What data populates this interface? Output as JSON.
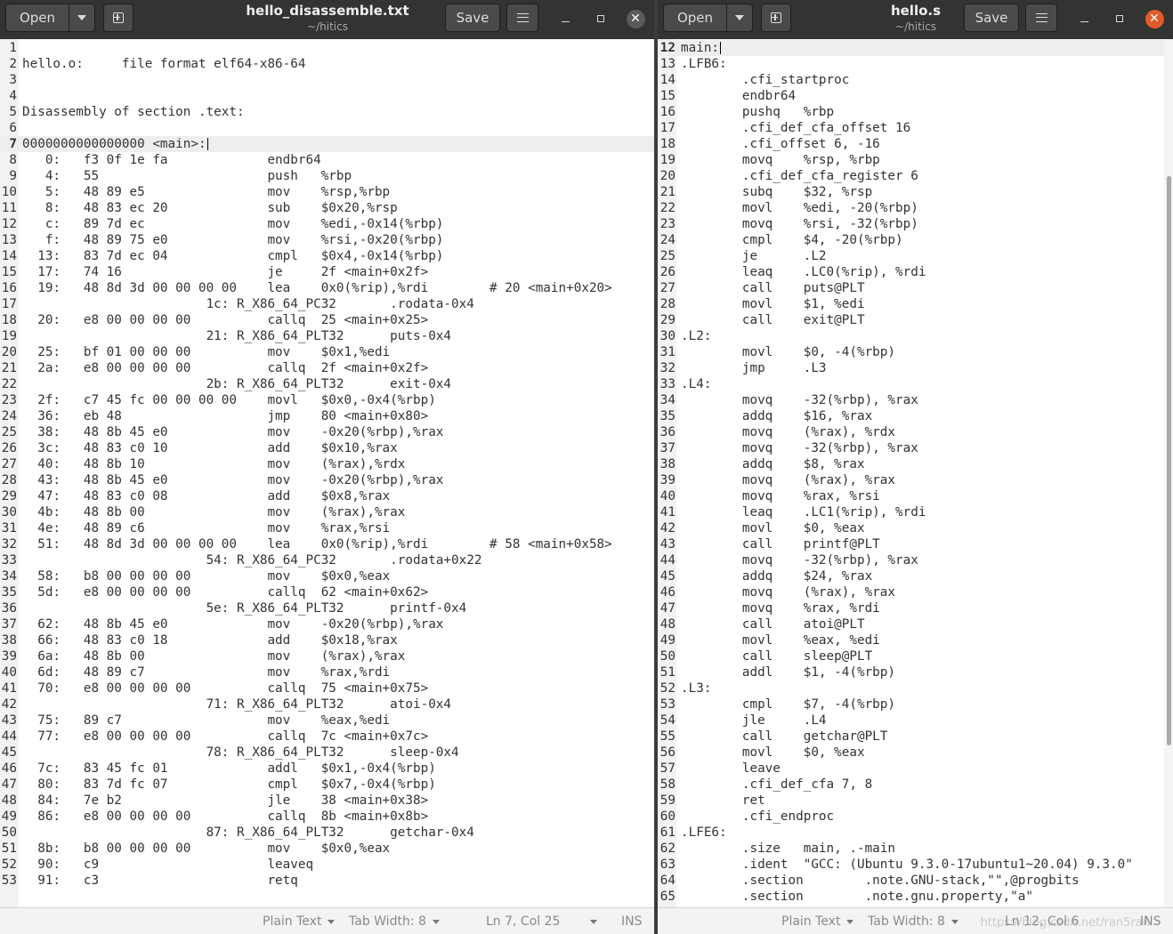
{
  "colors": {
    "header_bg": "#333333",
    "close_button": "#e35a2a",
    "editor_bg": "#ffffff",
    "current_line": "#eeeeec"
  },
  "left": {
    "open_label": "Open",
    "save_label": "Save",
    "title": "hello_disassemble.txt",
    "subtitle": "~/hitics",
    "current_line": 7,
    "lines": [
      "",
      "hello.o:     file format elf64-x86-64",
      "",
      "",
      "Disassembly of section .text:",
      "",
      "0000000000000000 <main>:",
      "   0:\tf3 0f 1e fa          \tendbr64 ",
      "   4:\t55                   \tpush   %rbp",
      "   5:\t48 89 e5             \tmov    %rsp,%rbp",
      "   8:\t48 83 ec 20          \tsub    $0x20,%rsp",
      "   c:\t89 7d ec             \tmov    %edi,-0x14(%rbp)",
      "   f:\t48 89 75 e0          \tmov    %rsi,-0x20(%rbp)",
      "  13:\t83 7d ec 04          \tcmpl   $0x4,-0x14(%rbp)",
      "  17:\t74 16                \tje     2f <main+0x2f>",
      "  19:\t48 8d 3d 00 00 00 00 \tlea    0x0(%rip),%rdi        # 20 <main+0x20>",
      "\t\t\t1c: R_X86_64_PC32\t.rodata-0x4",
      "  20:\te8 00 00 00 00       \tcallq  25 <main+0x25>",
      "\t\t\t21: R_X86_64_PLT32\tputs-0x4",
      "  25:\tbf 01 00 00 00       \tmov    $0x1,%edi",
      "  2a:\te8 00 00 00 00       \tcallq  2f <main+0x2f>",
      "\t\t\t2b: R_X86_64_PLT32\texit-0x4",
      "  2f:\tc7 45 fc 00 00 00 00 \tmovl   $0x0,-0x4(%rbp)",
      "  36:\teb 48                \tjmp    80 <main+0x80>",
      "  38:\t48 8b 45 e0          \tmov    -0x20(%rbp),%rax",
      "  3c:\t48 83 c0 10          \tadd    $0x10,%rax",
      "  40:\t48 8b 10             \tmov    (%rax),%rdx",
      "  43:\t48 8b 45 e0          \tmov    -0x20(%rbp),%rax",
      "  47:\t48 83 c0 08          \tadd    $0x8,%rax",
      "  4b:\t48 8b 00             \tmov    (%rax),%rax",
      "  4e:\t48 89 c6             \tmov    %rax,%rsi",
      "  51:\t48 8d 3d 00 00 00 00 \tlea    0x0(%rip),%rdi        # 58 <main+0x58>",
      "\t\t\t54: R_X86_64_PC32\t.rodata+0x22",
      "  58:\tb8 00 00 00 00       \tmov    $0x0,%eax",
      "  5d:\te8 00 00 00 00       \tcallq  62 <main+0x62>",
      "\t\t\t5e: R_X86_64_PLT32\tprintf-0x4",
      "  62:\t48 8b 45 e0          \tmov    -0x20(%rbp),%rax",
      "  66:\t48 83 c0 18          \tadd    $0x18,%rax",
      "  6a:\t48 8b 00             \tmov    (%rax),%rax",
      "  6d:\t48 89 c7             \tmov    %rax,%rdi",
      "  70:\te8 00 00 00 00       \tcallq  75 <main+0x75>",
      "\t\t\t71: R_X86_64_PLT32\tatoi-0x4",
      "  75:\t89 c7                \tmov    %eax,%edi",
      "  77:\te8 00 00 00 00       \tcallq  7c <main+0x7c>",
      "\t\t\t78: R_X86_64_PLT32\tsleep-0x4",
      "  7c:\t83 45 fc 01          \taddl   $0x1,-0x4(%rbp)",
      "  80:\t83 7d fc 07          \tcmpl   $0x7,-0x4(%rbp)",
      "  84:\t7e b2                \tjle    38 <main+0x38>",
      "  86:\te8 00 00 00 00       \tcallq  8b <main+0x8b>",
      "\t\t\t87: R_X86_64_PLT32\tgetchar-0x4",
      "  8b:\tb8 00 00 00 00       \tmov    $0x0,%eax",
      "  90:\tc9                   \tleaveq ",
      "  91:\tc3                   \tretq   "
    ],
    "status": {
      "language": "Plain Text",
      "tab_width": "Tab Width: 8",
      "position": "Ln 7, Col 25",
      "mode": "INS"
    }
  },
  "right": {
    "open_label": "Open",
    "save_label": "Save",
    "title": "hello.s",
    "subtitle": "~/hitics",
    "first_line": 12,
    "current_line": 12,
    "lines": [
      "main:",
      ".LFB6:",
      "\t.cfi_startproc",
      "\tendbr64",
      "\tpushq\t%rbp",
      "\t.cfi_def_cfa_offset 16",
      "\t.cfi_offset 6, -16",
      "\tmovq\t%rsp, %rbp",
      "\t.cfi_def_cfa_register 6",
      "\tsubq\t$32, %rsp",
      "\tmovl\t%edi, -20(%rbp)",
      "\tmovq\t%rsi, -32(%rbp)",
      "\tcmpl\t$4, -20(%rbp)",
      "\tje\t.L2",
      "\tleaq\t.LC0(%rip), %rdi",
      "\tcall\tputs@PLT",
      "\tmovl\t$1, %edi",
      "\tcall\texit@PLT",
      ".L2:",
      "\tmovl\t$0, -4(%rbp)",
      "\tjmp\t.L3",
      ".L4:",
      "\tmovq\t-32(%rbp), %rax",
      "\taddq\t$16, %rax",
      "\tmovq\t(%rax), %rdx",
      "\tmovq\t-32(%rbp), %rax",
      "\taddq\t$8, %rax",
      "\tmovq\t(%rax), %rax",
      "\tmovq\t%rax, %rsi",
      "\tleaq\t.LC1(%rip), %rdi",
      "\tmovl\t$0, %eax",
      "\tcall\tprintf@PLT",
      "\tmovq\t-32(%rbp), %rax",
      "\taddq\t$24, %rax",
      "\tmovq\t(%rax), %rax",
      "\tmovq\t%rax, %rdi",
      "\tcall\tatoi@PLT",
      "\tmovl\t%eax, %edi",
      "\tcall\tsleep@PLT",
      "\taddl\t$1, -4(%rbp)",
      ".L3:",
      "\tcmpl\t$7, -4(%rbp)",
      "\tjle\t.L4",
      "\tcall\tgetchar@PLT",
      "\tmovl\t$0, %eax",
      "\tleave",
      "\t.cfi_def_cfa 7, 8",
      "\tret",
      "\t.cfi_endproc",
      ".LFE6:",
      "\t.size\tmain, .-main",
      "\t.ident\t\"GCC: (Ubuntu 9.3.0-17ubuntu1~20.04) 9.3.0\"",
      "\t.section\t.note.GNU-stack,\"\",@progbits",
      "\t.section\t.note.gnu.property,\"a\""
    ],
    "status": {
      "language": "Plain Text",
      "tab_width": "Tab Width: 8",
      "position": "Ln 12, Col 6",
      "mode": "INS"
    },
    "watermark": "https://blog.csdn.net/ran5ran"
  }
}
